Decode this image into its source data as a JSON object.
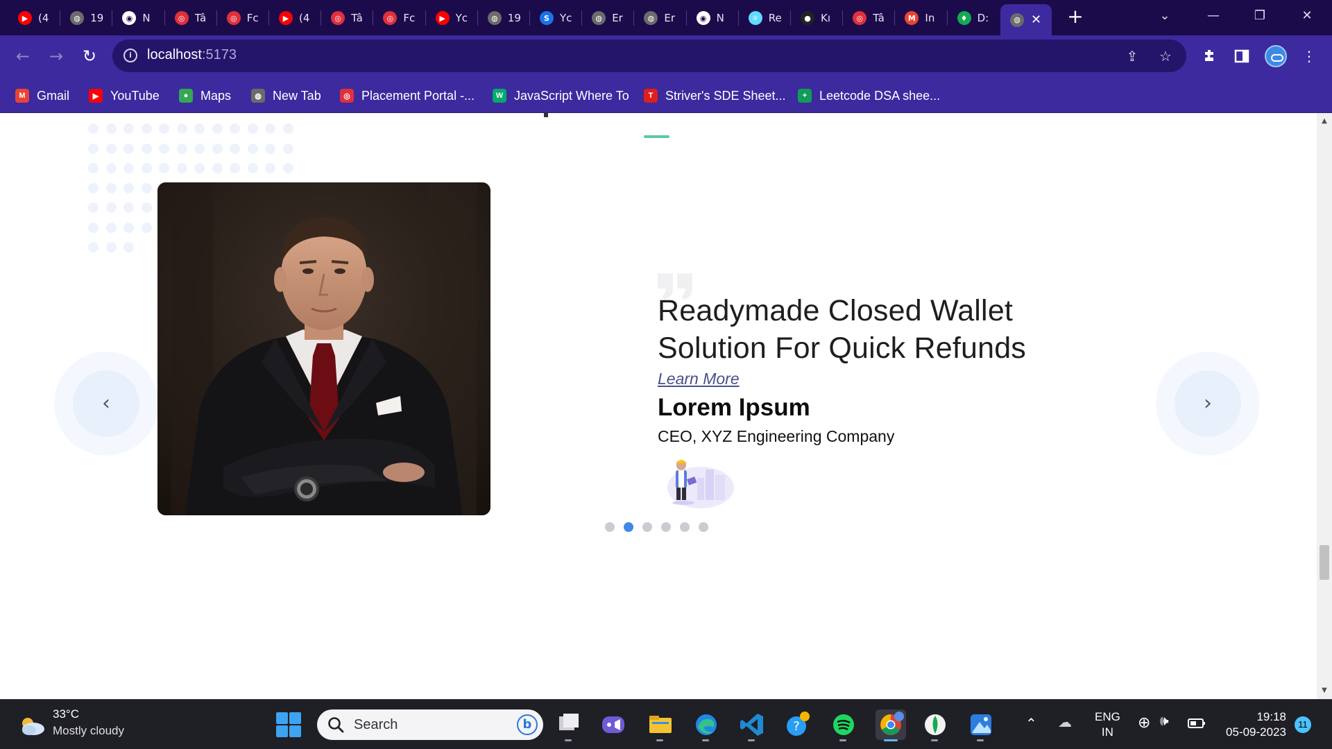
{
  "browser": {
    "tabs": [
      {
        "label": "(4",
        "icon": "youtube-icon",
        "color": "#ff0000"
      },
      {
        "label": "19",
        "icon": "globe-icon",
        "color": "#6b6b6b"
      },
      {
        "label": "N",
        "icon": "chrome-icon",
        "color": "#ffffff"
      },
      {
        "label": "Tâ",
        "icon": "portal-icon",
        "color": "#e0303c"
      },
      {
        "label": "Fc",
        "icon": "portal-icon",
        "color": "#e0303c"
      },
      {
        "label": "(4",
        "icon": "youtube-icon",
        "color": "#ff0000"
      },
      {
        "label": "Tâ",
        "icon": "portal-icon",
        "color": "#e0303c"
      },
      {
        "label": "Fc",
        "icon": "portal-icon",
        "color": "#e0303c"
      },
      {
        "label": "Yc",
        "icon": "youtube-icon",
        "color": "#ff0000"
      },
      {
        "label": "19",
        "icon": "globe-icon",
        "color": "#6b6b6b"
      },
      {
        "label": "Yc",
        "icon": "s-icon",
        "color": "#1a73e8"
      },
      {
        "label": "Er",
        "icon": "globe-icon",
        "color": "#6b6b6b"
      },
      {
        "label": "Er",
        "icon": "globe-icon",
        "color": "#6b6b6b"
      },
      {
        "label": "N",
        "icon": "chrome-icon",
        "color": "#ffffff"
      },
      {
        "label": "Re",
        "icon": "react-icon",
        "color": "#61dafb"
      },
      {
        "label": "Kı",
        "icon": "github-icon",
        "color": "#222222"
      },
      {
        "label": "Tâ",
        "icon": "portal-icon",
        "color": "#e0303c"
      },
      {
        "label": "In",
        "icon": "gmail-icon",
        "color": "#ea4335"
      },
      {
        "label": "D:",
        "icon": "mongodb-icon",
        "color": "#13aa52"
      }
    ],
    "active_tab_close": "✕",
    "new_tab": "+",
    "window_controls": {
      "minimize": "—",
      "restore": "❐",
      "close": "✕",
      "tab_search": "⌄"
    },
    "address": {
      "host": "localhost",
      "port": ":5173"
    },
    "nav": {
      "back": "←",
      "forward": "→",
      "reload": "↻"
    },
    "bookmarks": [
      {
        "label": "Gmail",
        "icon": "gmail-icon",
        "color": "#ea4335"
      },
      {
        "label": "YouTube",
        "icon": "youtube-icon",
        "color": "#ff0000"
      },
      {
        "label": "Maps",
        "icon": "maps-icon",
        "color": "#34a853"
      },
      {
        "label": "New Tab",
        "icon": "globe-icon",
        "color": "#6b6b6b"
      },
      {
        "label": "Placement Portal -...",
        "icon": "portal-icon",
        "color": "#e0303c"
      },
      {
        "label": "JavaScript Where To",
        "icon": "w3-icon",
        "color": "#04aa6d"
      },
      {
        "label": "Striver's SDE Sheet...",
        "icon": "tuf-icon",
        "color": "#e01e1e"
      },
      {
        "label": "Leetcode DSA shee...",
        "icon": "sheets-icon",
        "color": "#0f9d58"
      }
    ]
  },
  "testimonial": {
    "headline_line1": "Readymade Closed Wallet",
    "headline_line2": "Solution For Quick Refunds",
    "link_label": "Learn More",
    "name": "Lorem Ipsum",
    "role": "CEO, XYZ Engineering Company",
    "accent_color": "#5bc9a6",
    "pager_count": 6,
    "pager_active": 2,
    "prev_label": "‹",
    "next_label": "›"
  },
  "taskbar": {
    "weather_temp": "33°C",
    "weather_desc": "Mostly cloudy",
    "search_placeholder": "Search",
    "lang_line1": "ENG",
    "lang_line2": "IN",
    "time": "19:18",
    "date": "05-09-2023",
    "notification_count": "11",
    "apps": [
      "file-view-icon",
      "meet-icon",
      "file-explorer-icon",
      "edge-icon",
      "vscode-icon",
      "help-icon",
      "spotify-icon",
      "chrome-icon",
      "mongodb-compass-icon",
      "photos-icon"
    ]
  }
}
